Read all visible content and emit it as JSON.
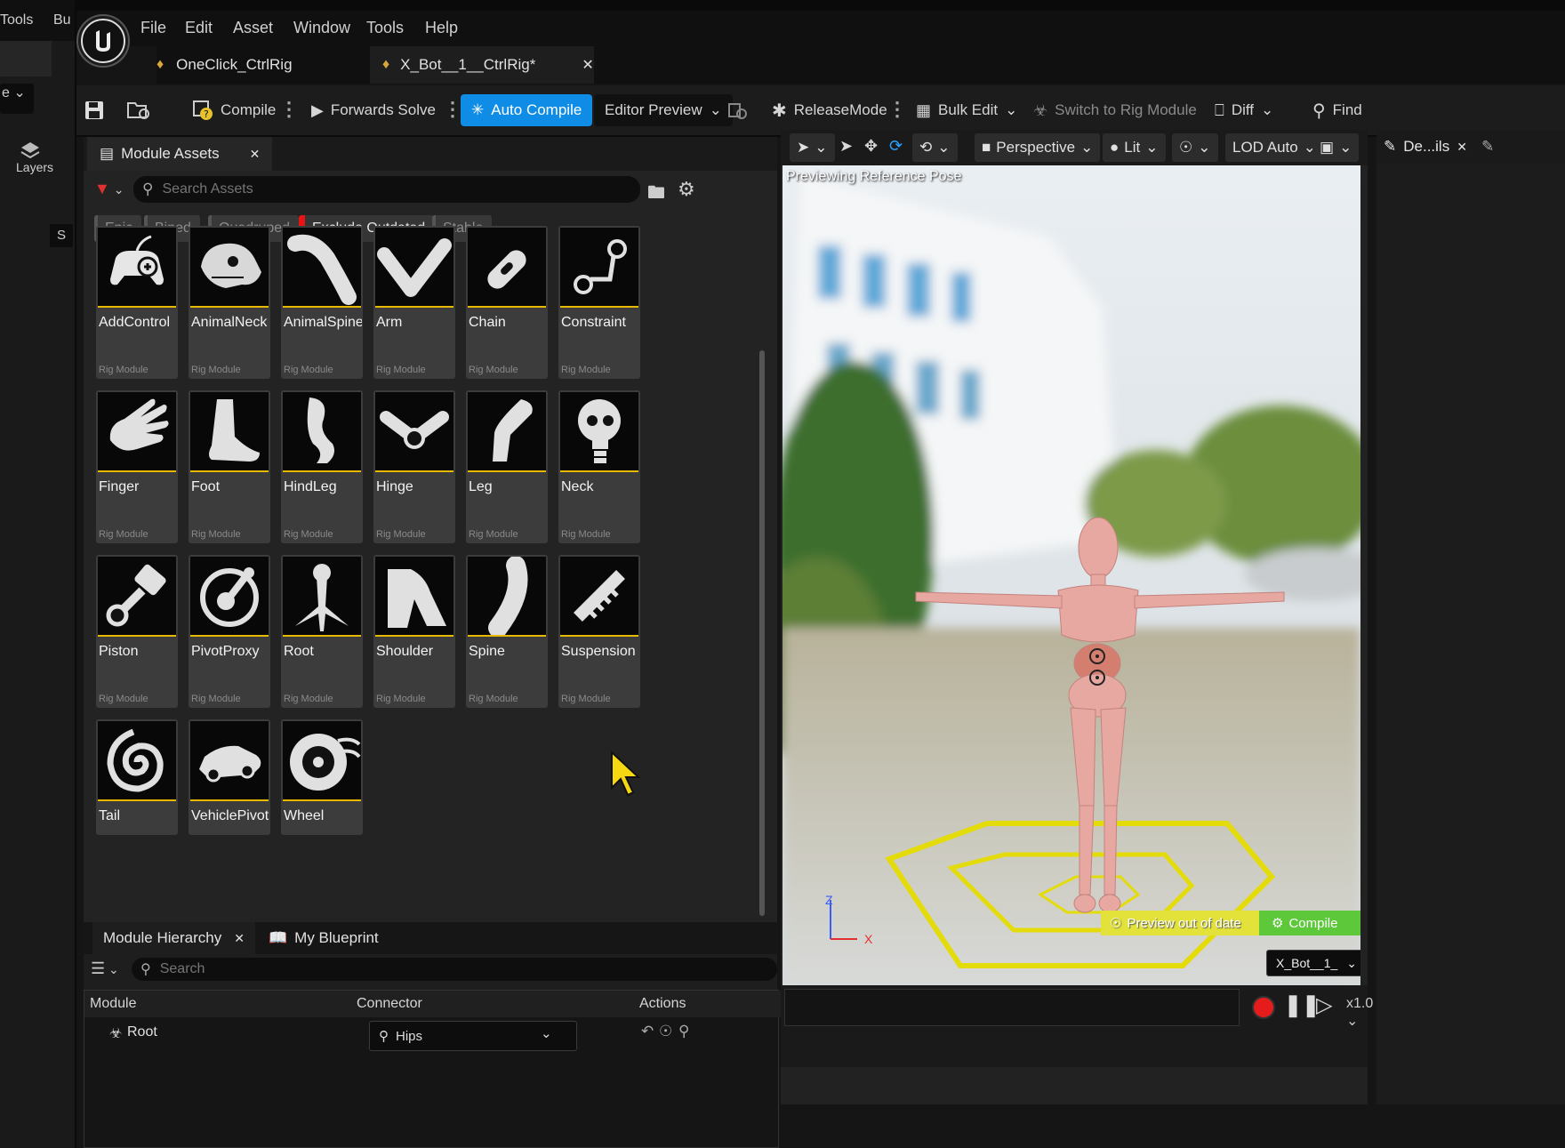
{
  "left_strip": {
    "tools_label": "Tools",
    "bu_label": "Bu",
    "layers_label": "Layers",
    "s_label": "S",
    "e_label": "e"
  },
  "menu": [
    "File",
    "Edit",
    "Asset",
    "Window",
    "Tools",
    "Help"
  ],
  "doc_tabs": [
    {
      "label": "OneClick_CtrlRig"
    },
    {
      "label": "X_Bot__1__CtrlRig*"
    }
  ],
  "toolbar": {
    "compile": "Compile",
    "forwards_solve": "Forwards Solve",
    "auto_compile": "Auto Compile",
    "editor_preview": "Editor Preview",
    "release_mode": "ReleaseMode",
    "bulk_edit": "Bulk Edit",
    "switch_rig": "Switch to Rig Module",
    "diff": "Diff",
    "find": "Find"
  },
  "assets": {
    "tab_label": "Module Assets",
    "search_placeholder": "Search Assets",
    "filters": [
      "Epic",
      "Biped",
      "Quadruped",
      "Exclude Outdated",
      "Stable"
    ],
    "subtitle": "Rig Module",
    "items": [
      "AddControl",
      "AnimalNeck",
      "AnimalSpine",
      "Arm",
      "Chain",
      "Constraint",
      "Finger",
      "Foot",
      "HindLeg",
      "Hinge",
      "Leg",
      "Neck",
      "Piston",
      "PivotProxy",
      "Root",
      "Shoulder",
      "Spine",
      "Suspension",
      "Tail",
      "VehiclePivot...",
      "Wheel"
    ]
  },
  "hierarchy": {
    "tab_label": "Module Hierarchy",
    "blueprint_tab": "My Blueprint",
    "search_placeholder": "Search",
    "columns": [
      "Module",
      "Connector",
      "Actions"
    ],
    "row": {
      "module": "Root",
      "connector": "Hips"
    }
  },
  "viewport": {
    "perspective": "Perspective",
    "lit": "Lit",
    "lod": "LOD Auto",
    "overlay": "Previewing Reference Pose",
    "preview_out_of_date": "Preview out of date",
    "compile": "Compile",
    "asset_dd": "X_Bot__1_",
    "axis_z": "Z",
    "axis_x": "X",
    "speed": "x1.0"
  },
  "details": {
    "tab_label": "De...ils"
  },
  "colors": {
    "accent_blue": "#0f8ce5",
    "tile_yellow": "#e6b800",
    "filter_red": "#e81414",
    "compile_green": "#5cc83a",
    "warn_yellow": "#e0e030"
  }
}
